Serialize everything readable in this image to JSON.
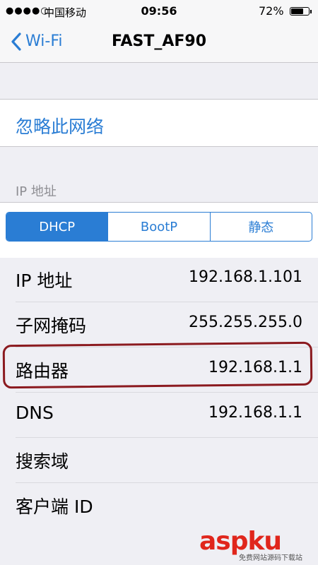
{
  "status_bar": {
    "signal": "●●●●○",
    "carrier": "中国移动",
    "time": "09:56",
    "battery_percent": "72%",
    "battery_level": 0.72
  },
  "nav": {
    "back_label": "Wi-Fi",
    "title": "FAST_AF90"
  },
  "forget_network_label": "忽略此网络",
  "ip_section": {
    "header": "IP 地址",
    "segments": [
      "DHCP",
      "BootP",
      "静态"
    ],
    "selected_segment": "DHCP",
    "rows": [
      {
        "label": "IP 地址",
        "value": "192.168.1.101"
      },
      {
        "label": "子网掩码",
        "value": "255.255.255.0"
      },
      {
        "label": "路由器",
        "value": "192.168.1.1"
      },
      {
        "label": "DNS",
        "value": "192.168.1.1"
      },
      {
        "label": "搜索域",
        "value": ""
      },
      {
        "label": "客户端 ID",
        "value": ""
      }
    ]
  },
  "watermark": {
    "logo_text": "aspku",
    "sub_text": "免费网站源码下载站"
  },
  "colors": {
    "accent": "#2a7dd4",
    "highlight": "#8b1a1f",
    "background": "#efeff4"
  }
}
